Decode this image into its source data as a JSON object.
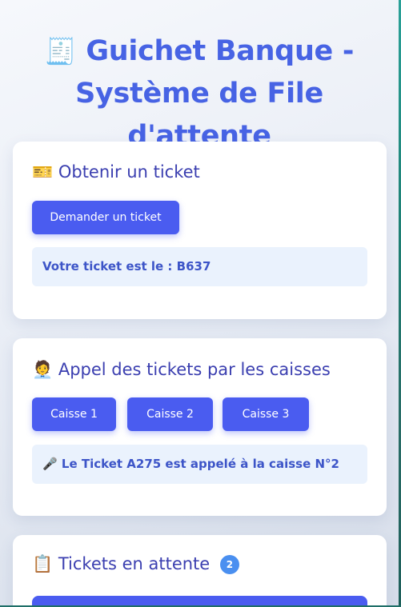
{
  "header": {
    "icon": "receipt-icon",
    "icon_glyph": "🧾",
    "title_line1": "Guichet Banque -",
    "title_line2": "Système de File d'attente"
  },
  "ticket_section": {
    "icon": "ticket-icon",
    "icon_glyph": "🎫",
    "heading": "Obtenir un ticket",
    "button_label": "Demander un ticket",
    "result_text": "Votre ticket est le : B637"
  },
  "calls_section": {
    "icon": "teller-person-icon",
    "icon_glyph": "🧑‍💼",
    "heading": "Appel des tickets par les caisses",
    "buttons": [
      {
        "label": "Caisse 1"
      },
      {
        "label": "Caisse 2"
      },
      {
        "label": "Caisse 3"
      }
    ],
    "announcement_icon": "microphone-icon",
    "announcement_glyph": "🎤",
    "announcement_text": "Le Ticket A275 est appelé à la caisse N°2"
  },
  "waiting_section": {
    "icon": "clipboard-icon",
    "icon_glyph": "📋",
    "heading": "Tickets en attente",
    "count": "2"
  },
  "colors": {
    "accent": "#4a5cf0",
    "title": "#4763e4",
    "heading": "#3b3fb0",
    "info_bg": "#eaf2fd",
    "badge": "#4a8ff0"
  }
}
